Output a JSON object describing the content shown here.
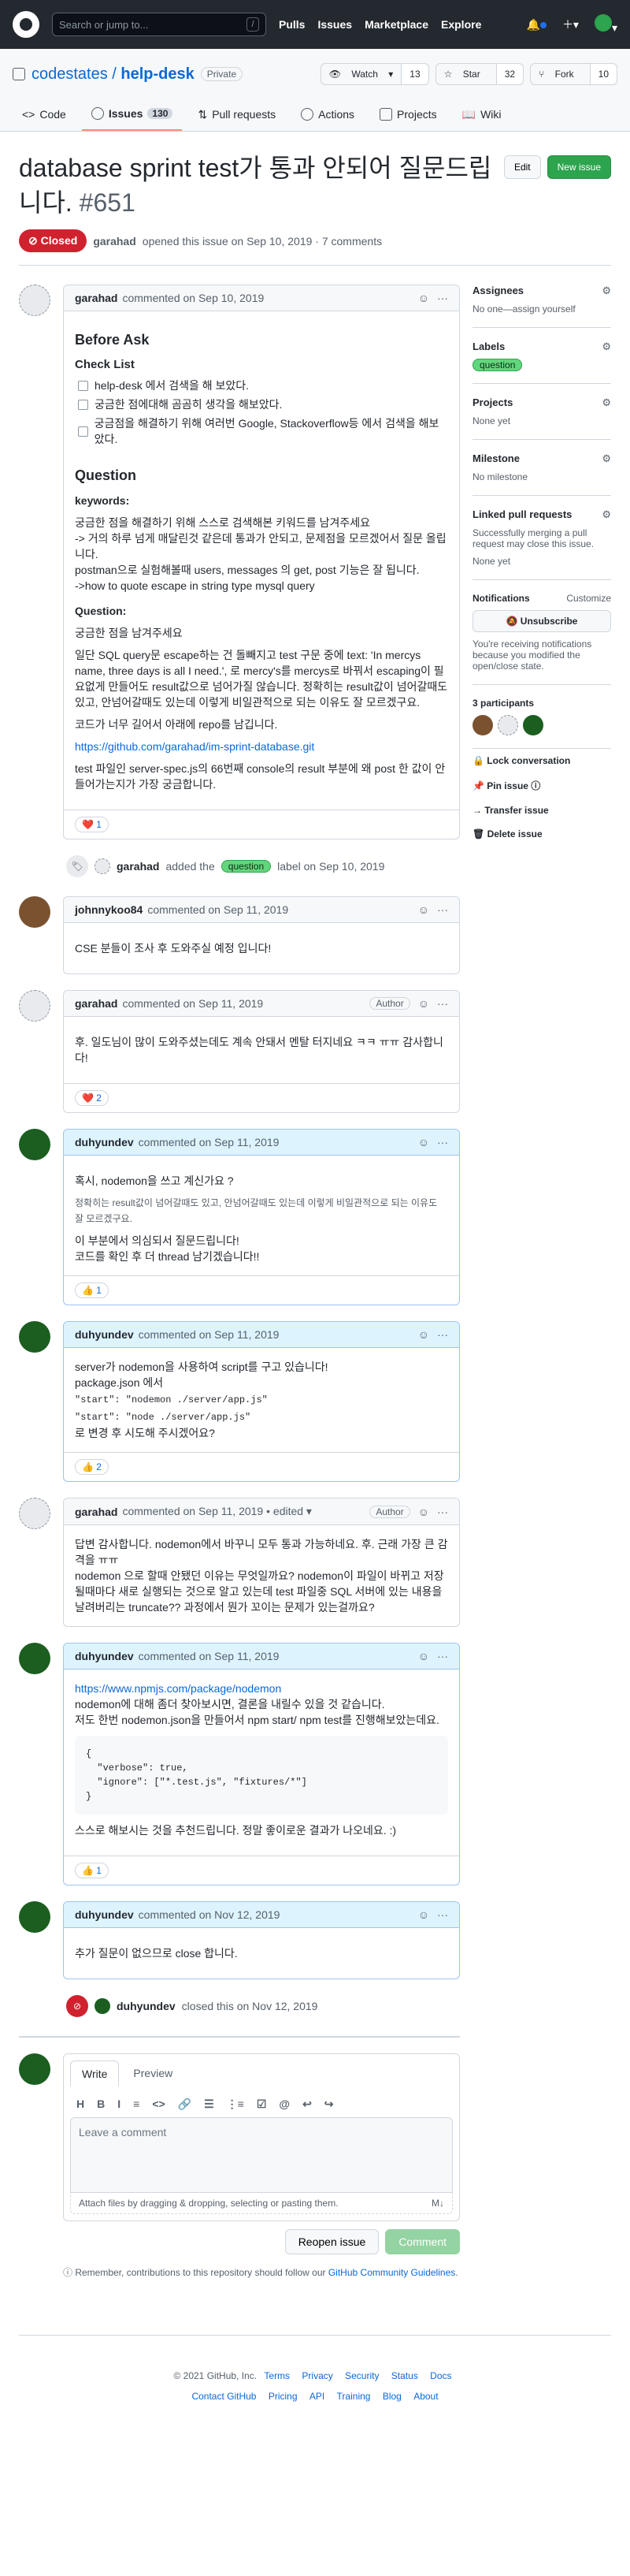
{
  "header": {
    "search_placeholder": "Search or jump to...",
    "search_key": "/",
    "nav": [
      "Pulls",
      "Issues",
      "Marketplace",
      "Explore"
    ]
  },
  "repo": {
    "owner": "codestates",
    "name": "help-desk",
    "visibility": "Private",
    "watch": "Watch",
    "watch_count": "13",
    "star": "Star",
    "star_count": "32",
    "fork": "Fork",
    "fork_count": "10",
    "tabs": [
      {
        "label": "Code"
      },
      {
        "label": "Issues",
        "count": "130"
      },
      {
        "label": "Pull requests"
      },
      {
        "label": "Actions"
      },
      {
        "label": "Projects"
      },
      {
        "label": "Wiki"
      }
    ]
  },
  "issue": {
    "title": "database sprint test가 통과 안되어 질문드립니다.",
    "number": "#651",
    "edit": "Edit",
    "new_issue": "New issue",
    "state": "Closed",
    "author": "garahad",
    "meta": "opened this issue on Sep 10, 2019 · 7 comments"
  },
  "first": {
    "author": "garahad",
    "when": "commented on Sep 10, 2019",
    "h_before": "Before Ask",
    "h_check": "Check List",
    "checks": [
      "help-desk 에서 검색을 해 보았다.",
      "궁금한 점에대해 곰곰히 생각을 해보았다.",
      "궁금점을 해결하기 위해 여러번 Google, Stackoverflow등 에서 검색을 해보았다."
    ],
    "h_question": "Question",
    "h_keywords": "keywords:",
    "kw1": "궁금한 점을 해결하기 위해 스스로 검색해본 키워드를 남겨주세요",
    "kw2": "-> 거의 하루 넘게 매달린것 같은데 통과가 안되고, 문제점을 모르겠어서 질문 올립니다.",
    "kw3": "postman으로 실험해볼때 users, messages 의 get, post 기능은 잘 됩니다.",
    "kw4": "->how to quote escape in string type mysql query",
    "h_q2": "Question:",
    "q1": "궁금한 점을 남겨주세요",
    "q2": "일단 SQL query문 escape하는 건 돌빼지고 test 구문 중에 text: 'In mercys name, three days is all I need.', 로 mercy's를 mercys로 바꿔서 escaping이 필요없게 만들어도 result값으로 넘어가질 않습니다. 정확히는 result값이 넘어갈때도 있고, 안넘어갈때도 있는데 이렇게 비일관적으로 되는 이유도 잘 모르겠구요.",
    "q3": "코드가 너무 길어서 아래에 repo를 남깁니다.",
    "link": "https://github.com/garahad/im-sprint-database.git",
    "q4": "test 파일인 server-spec.js의 66번째 console의 result 부분에 왜 post 한 값이 안들어가는지가 가장 궁금합니다.",
    "reaction": "❤️ 1"
  },
  "label_event": {
    "author": "garahad",
    "text": "added the",
    "label": "question",
    "suffix": "label on Sep 10, 2019"
  },
  "c1": {
    "author": "johnnykoo84",
    "when": "commented on Sep 11, 2019",
    "body": "CSE 분들이 조사 후 도와주실 예정 입니다!"
  },
  "c2": {
    "author": "garahad",
    "when": "commented on Sep 11, 2019",
    "role": "Author",
    "body": "후. 일도님이 많이 도와주셨는데도 계속 안돼서 멘탈 터지네요 ㅋㅋ ㅠㅠ 감사합니다!",
    "reaction": "❤️ 2"
  },
  "c3": {
    "author": "duhyundev",
    "when": "commented on Sep 11, 2019",
    "l1": "혹시, nodemon을 쓰고 계신가요 ?",
    "quote": "정확히는 result값이 넘어갈때도 있고, 안넘어갈때도 있는데 이렇게 비일관적으로 되는 이유도 잘 모르겠구요.",
    "l2": "이 부분에서 의심되서 질문드립니다!",
    "l3": "코드를 확인 후 더 thread 남기겠습니다!!",
    "reaction": "👍 1"
  },
  "c4": {
    "author": "duhyundev",
    "when": "commented on Sep 11, 2019",
    "l1": "server가 nodemon을 사용하여 script를 구고 있습니다!",
    "l2": "package.json 에서",
    "code1": "\"start\": \"nodemon ./server/app.js\"",
    "code2": "\"start\": \"node ./server/app.js\"",
    "l3": "로 변경 후 시도해 주시겠어요?",
    "reaction": "👍 2"
  },
  "c5": {
    "author": "garahad",
    "when": "commented on Sep 11, 2019 • edited ▾",
    "role": "Author",
    "l1": "답변 감사합니다. nodemon에서 바꾸니 모두 통과 가능하네요. 후. 근래 가장 큰 감격을 ㅠㅠ",
    "l2": "nodemon 으로 할때 안됐던 이유는 무엇일까요? nodemon이 파일이 바뀌고 저장될때마다 새로 실행되는 것으로 알고 있는데 test 파일중 SQL 서버에 있는 내용을 날려버리는 truncate?? 과정에서 뭔가 꼬이는 문제가 있는걸까요?"
  },
  "c6": {
    "author": "duhyundev",
    "when": "commented on Sep 11, 2019",
    "link": "https://www.npmjs.com/package/nodemon",
    "l1": "nodemon에 대해 좀더 찾아보시면, 결론을 내릴수 있을 것 같습니다.",
    "l2": "저도 한번 nodemon.json을 만들어서 npm start/ npm test를 진행해보았는데요.",
    "code": "{\n  \"verbose\": true,\n  \"ignore\": [\"*.test.js\", \"fixtures/*\"]\n}",
    "l3": "스스로 해보시는 것을 추천드립니다. 정말 좋이로운 결과가 나오네요. :)",
    "reaction": "👍 1"
  },
  "c7": {
    "author": "duhyundev",
    "when": "commented on Nov 12, 2019",
    "body": "추가 질문이 없으므로 close 합니다."
  },
  "close_event": {
    "author": "duhyundev",
    "text": "closed this on Nov 12, 2019"
  },
  "sidebar": {
    "assignees": "Assignees",
    "assignees_val": "No one—assign yourself",
    "labels": "Labels",
    "label": "question",
    "projects": "Projects",
    "projects_val": "None yet",
    "milestone": "Milestone",
    "milestone_val": "No milestone",
    "linked": "Linked pull requests",
    "linked_desc": "Successfully merging a pull request may close this issue.",
    "linked_val": "None yet",
    "notif": "Notifications",
    "customize": "Customize",
    "unsub": "Unsubscribe",
    "notif_desc": "You're receiving notifications because you modified the open/close state.",
    "participants": "3 participants",
    "lock": "Lock conversation",
    "pin": "Pin issue",
    "transfer": "Transfer issue",
    "delete": "Delete issue"
  },
  "editor": {
    "write": "Write",
    "preview": "Preview",
    "tools": [
      "H",
      "B",
      "I",
      "≡",
      "<>",
      "🔗",
      "☰",
      "⋮≡",
      "☑",
      "@",
      "↩",
      "↪"
    ],
    "placeholder": "Leave a comment",
    "attach": "Attach files by dragging & dropping, selecting or pasting them.",
    "reopen": "Reopen issue",
    "comment": "Comment",
    "tip": "Remember, contributions to this repository should follow our",
    "tip_link": "GitHub Community Guidelines"
  },
  "footer": {
    "copy": "© 2021 GitHub, Inc.",
    "links1": [
      "Terms",
      "Privacy",
      "Security",
      "Status",
      "Docs"
    ],
    "links2": [
      "Contact GitHub",
      "Pricing",
      "API",
      "Training",
      "Blog",
      "About"
    ]
  }
}
